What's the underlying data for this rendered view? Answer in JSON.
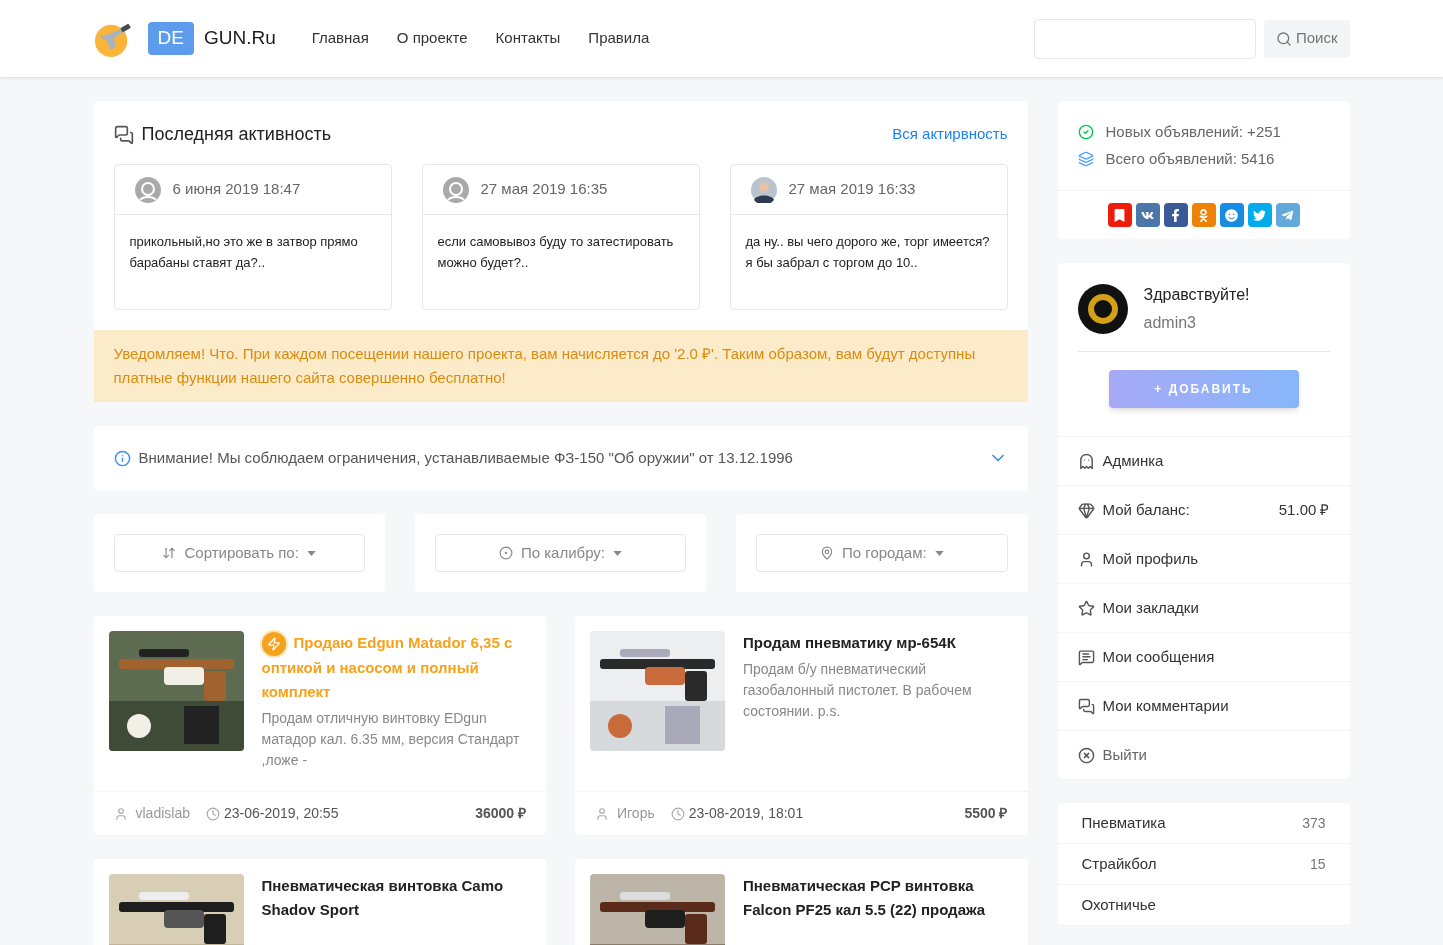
{
  "header": {
    "logo_badge": "DE",
    "logo_text": "GUN.Ru",
    "nav": [
      {
        "label": "Главная"
      },
      {
        "label": "О проекте"
      },
      {
        "label": "Контакты"
      },
      {
        "label": "Правила"
      }
    ],
    "search_button": "Поиск"
  },
  "activity": {
    "title": "Последняя активность",
    "all_link": "Вся актирвность",
    "items": [
      {
        "kind": "default",
        "date": "6 июня 2019 18:47",
        "text": "прикольный,но это же в затвор прямо барабаны ставят да?.."
      },
      {
        "kind": "default",
        "date": "27 мая 2019 16:35",
        "text": "если самовывоз буду то затестировать можно будет?.."
      },
      {
        "date": "27 мая 2019 16:33",
        "text": "да ну.. вы чего дорого же, торг имеется? я бы забрал с торгом до 10.."
      }
    ]
  },
  "notice": "Уведомляем! Что. При каждом посещении нашего проекта, вам начисляется до '2.0 ₽'. Таким образом, вам будут доступны платные функции нашего сайта совершенно бесплатно!",
  "warning": {
    "text": "Внимание! Мы соблюдаем ограничения, устанавливаемые ФЗ-150 \"Об оружии\" от 13.12.1996",
    "expanded": false
  },
  "filters": [
    {
      "kind": "sort",
      "label": "Сортировать по:"
    },
    {
      "kind": "caliber",
      "label": "По калибру:"
    },
    {
      "kind": "city",
      "label": "По городам:"
    }
  ],
  "listings": [
    {
      "featured": true,
      "title": "Продаю Edgun Matador 6,35 с оптикой и насосом и полный комплект",
      "description": "Продам отличную винтовку EDgun матадор кал. 6.35 мм, версия Стандарт ,ложе -",
      "author": "vladislab",
      "date": "23-06-2019, 20:55",
      "price": "36000 ₽"
    },
    {
      "featured": false,
      "title": "Продам пневматику мр-654К",
      "description": "Продам б/у пневматический газобалонный пистолет. В рабочем состоянии. p.s.",
      "author": "Игорь",
      "date": "23-08-2019, 18:01",
      "price": "5500 ₽"
    },
    {
      "featured": false,
      "title": "Пневматическая винтовка Camo Shadov Sport"
    },
    {
      "featured": false,
      "title": "Пневматическая PCP винтовка Falcon PF25 кал 5.5 (22) продажа"
    }
  ],
  "stats": [
    {
      "kind": "new",
      "text": "Новых объявлений: +251"
    },
    {
      "kind": "total",
      "text": "Всего объявлений: 5416"
    }
  ],
  "user": {
    "greeting": "Здравствуйте!",
    "name": "admin3",
    "add_button": "+ ДОБАВИТЬ"
  },
  "menu": [
    {
      "kind": "admin",
      "label": "Админка"
    },
    {
      "kind": "balance",
      "label": "Мой баланс:",
      "value": "51.00 ₽"
    },
    {
      "kind": "profile",
      "label": "Мой профиль"
    },
    {
      "kind": "bookmarks",
      "label": "Мои закладки"
    },
    {
      "kind": "messages",
      "label": "Мои сообщения"
    },
    {
      "kind": "comments",
      "label": "Мои комментарии"
    },
    {
      "kind": "logout",
      "label": "Выйти"
    }
  ],
  "categories": [
    {
      "label": "Пневматика",
      "count": "373"
    },
    {
      "label": "Страйкбол",
      "count": "15"
    },
    {
      "label": "Охотничье"
    }
  ]
}
